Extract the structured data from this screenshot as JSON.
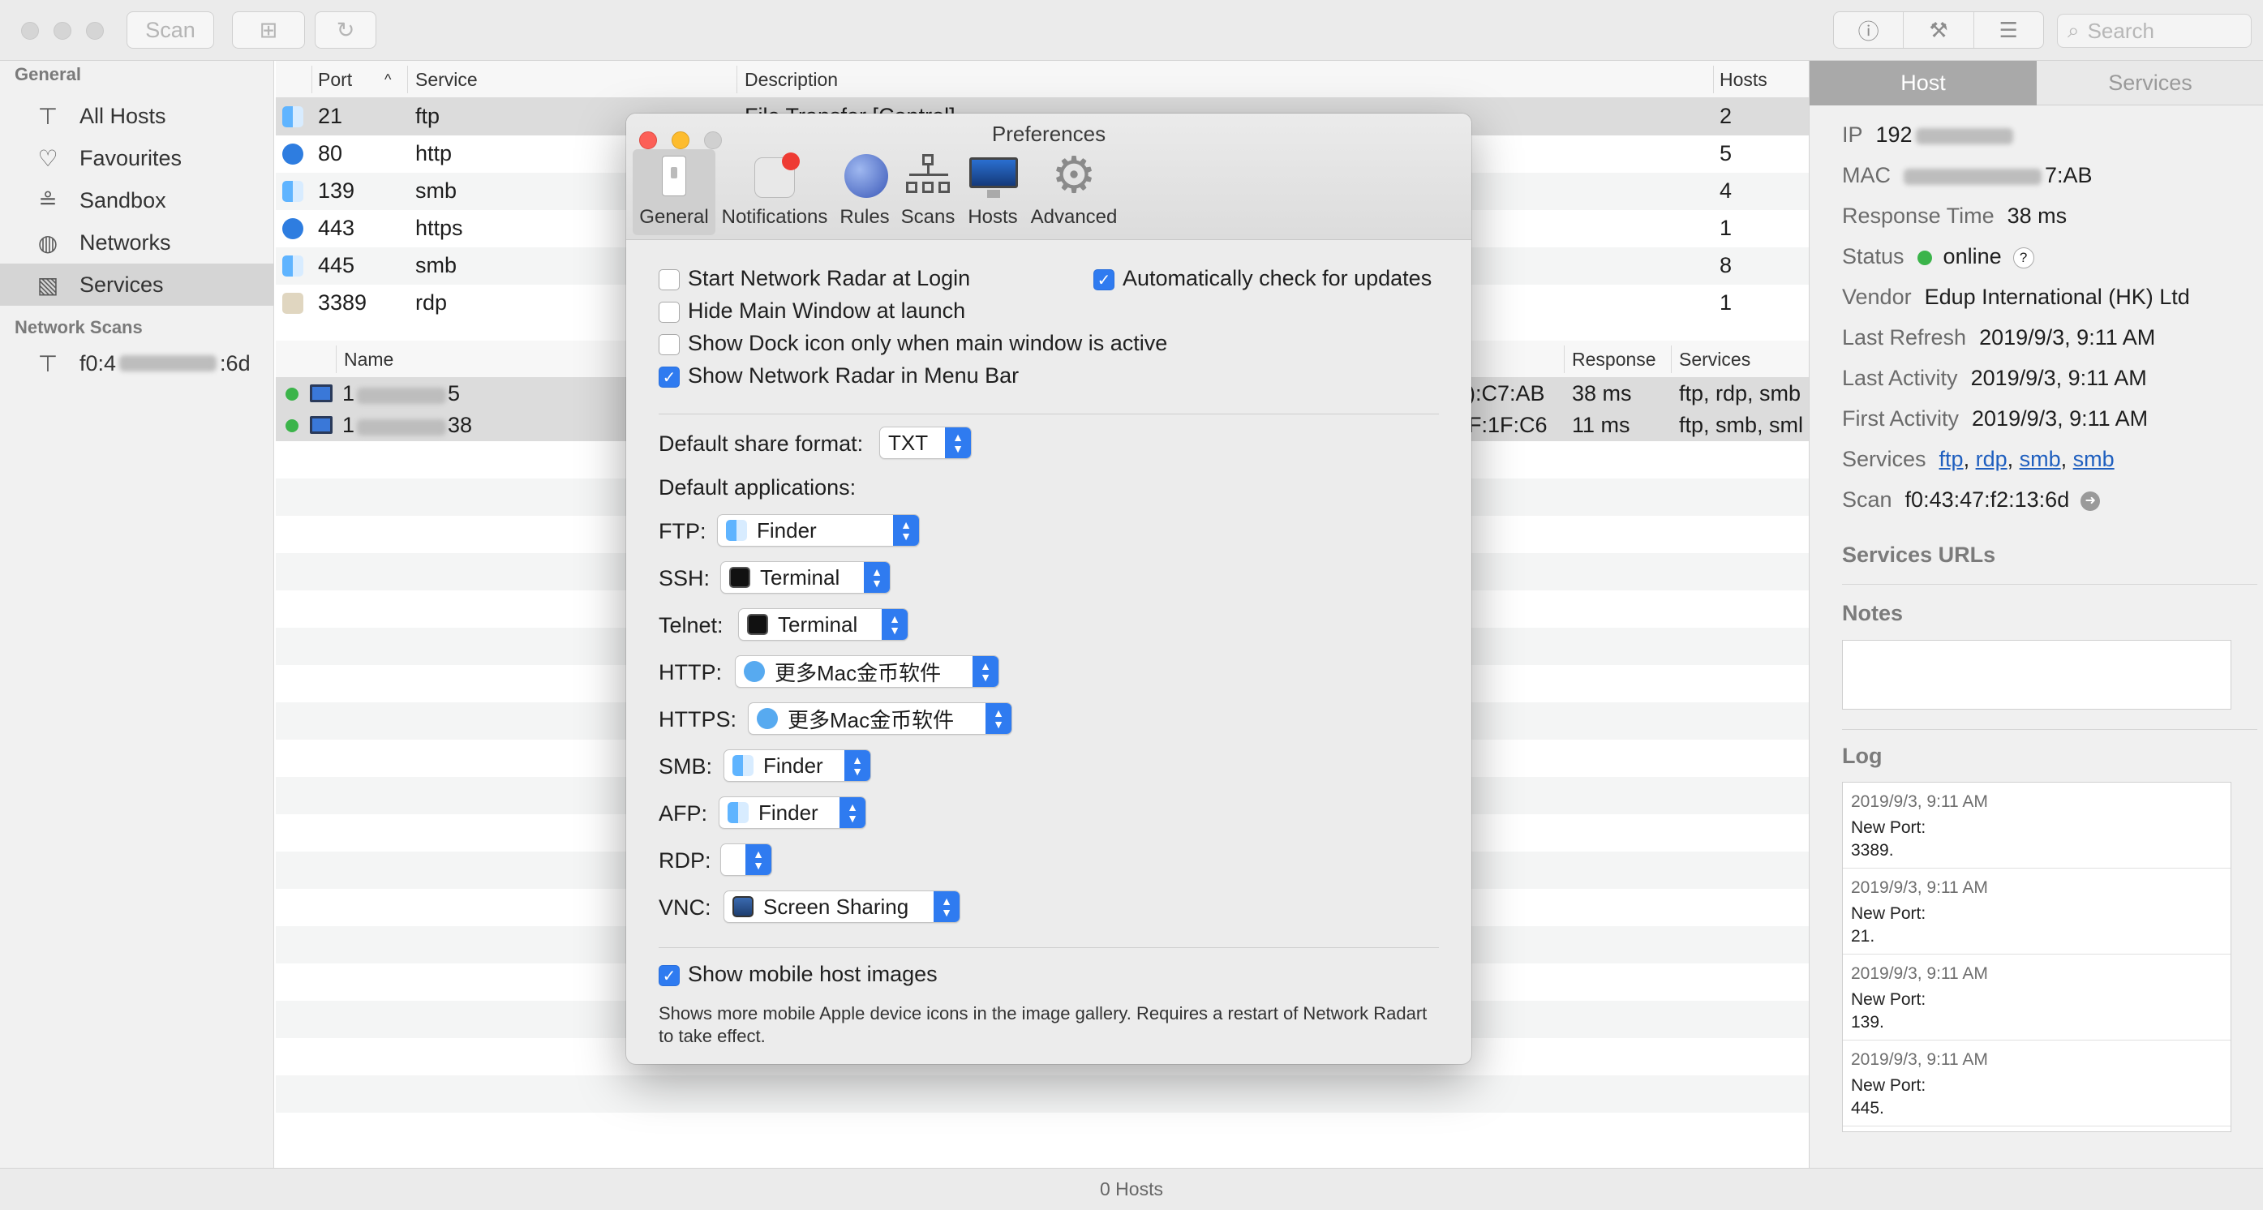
{
  "toolbar": {
    "scan_label": "Scan",
    "search_placeholder": "Search"
  },
  "sidebar": {
    "general_header": "General",
    "items": [
      {
        "label": "All Hosts",
        "icon": "hierarchy-icon"
      },
      {
        "label": "Favourites",
        "icon": "heart-icon"
      },
      {
        "label": "Sandbox",
        "icon": "sandbox-icon"
      },
      {
        "label": "Networks",
        "icon": "globe-icon"
      },
      {
        "label": "Services",
        "icon": "services-icon"
      }
    ],
    "scans_header": "Network Scans",
    "scan_item": {
      "prefix": "f0:4",
      "suffix": ":6d"
    }
  },
  "services_table": {
    "headers": {
      "port": "Port",
      "service": "Service",
      "description": "Description",
      "hosts": "Hosts"
    },
    "rows": [
      {
        "port": "21",
        "service": "ftp",
        "description": "File Transfer [Control]",
        "hosts": "2"
      },
      {
        "port": "80",
        "service": "http",
        "description": "",
        "hosts": "5"
      },
      {
        "port": "139",
        "service": "smb",
        "description": "",
        "hosts": "4"
      },
      {
        "port": "443",
        "service": "https",
        "description": "",
        "hosts": "1"
      },
      {
        "port": "445",
        "service": "smb",
        "description": "",
        "hosts": "8"
      },
      {
        "port": "3389",
        "service": "rdp",
        "description": "",
        "hosts": "1"
      }
    ]
  },
  "hosts_table": {
    "headers": {
      "name": "Name",
      "response": "Response",
      "services": "Services"
    },
    "rows": [
      {
        "name_prefix": "1",
        "name_suffix": "5",
        "mac_suffix": "):C7:AB",
        "response": "38 ms",
        "services": "ftp, rdp, smb"
      },
      {
        "name_prefix": "1",
        "name_suffix": "38",
        "mac_suffix": "F:1F:C6",
        "response": "11 ms",
        "services": "ftp, smb, sml"
      }
    ]
  },
  "inspector": {
    "tabs": [
      "Host",
      "Services"
    ],
    "ip_label": "IP",
    "ip_value": "192",
    "mac_label": "MAC",
    "mac_value": "7:AB",
    "response_label": "Response Time",
    "response_value": "38 ms",
    "status_label": "Status",
    "status_value": "online",
    "status_help": "?",
    "vendor_label": "Vendor",
    "vendor_value": "Edup International (HK) Ltd",
    "last_refresh_label": "Last Refresh",
    "last_refresh_value": "2019/9/3, 9:11 AM",
    "last_activity_label": "Last Activity",
    "last_activity_value": "2019/9/3, 9:11 AM",
    "first_activity_label": "First Activity",
    "first_activity_value": "2019/9/3, 9:11 AM",
    "services_label": "Services",
    "services_links": [
      "ftp",
      "rdp",
      "smb",
      "smb"
    ],
    "scan_label": "Scan",
    "scan_value": "f0:43:47:f2:13:6d",
    "services_urls_header": "Services URLs",
    "notes_header": "Notes",
    "log_header": "Log",
    "log": [
      {
        "date": "2019/9/3, 9:11 AM",
        "line1": "New Port:",
        "line2": "3389."
      },
      {
        "date": "2019/9/3, 9:11 AM",
        "line1": "New Port:",
        "line2": "21."
      },
      {
        "date": "2019/9/3, 9:11 AM",
        "line1": "New Port:",
        "line2": "139."
      },
      {
        "date": "2019/9/3, 9:11 AM",
        "line1": "New Port:",
        "line2": "445."
      }
    ]
  },
  "statusbar": {
    "text": "0 Hosts"
  },
  "preferences": {
    "title": "Preferences",
    "tabs": [
      {
        "label": "General",
        "icon": "switch-icon"
      },
      {
        "label": "Notifications",
        "icon": "notifications-icon"
      },
      {
        "label": "Rules",
        "icon": "globe-network-icon"
      },
      {
        "label": "Scans",
        "icon": "hierarchy-icon"
      },
      {
        "label": "Hosts",
        "icon": "imac-icon"
      },
      {
        "label": "Advanced",
        "icon": "gear-icon"
      }
    ],
    "checks": {
      "start_login": {
        "label": "Start Network Radar at Login",
        "checked": false
      },
      "hide_main": {
        "label": "Hide Main Window at launch",
        "checked": false
      },
      "dock_icon": {
        "label": "Show Dock icon only when main window is active",
        "checked": false
      },
      "menu_bar": {
        "label": "Show Network Radar in Menu Bar",
        "checked": true
      },
      "auto_update": {
        "label": "Automatically check for updates",
        "checked": true
      },
      "mobile_images": {
        "label": "Show mobile host images",
        "checked": true
      }
    },
    "share_format_label": "Default share format:",
    "share_format_value": "TXT",
    "default_apps_label": "Default applications:",
    "apps": {
      "ftp": {
        "label": "FTP:",
        "value": "Finder"
      },
      "ssh": {
        "label": "SSH:",
        "value": "Terminal"
      },
      "telnet": {
        "label": "Telnet:",
        "value": "Terminal"
      },
      "http": {
        "label": "HTTP:",
        "value": "更多Mac金币软件"
      },
      "https": {
        "label": "HTTPS:",
        "value": "更多Mac金币软件"
      },
      "smb": {
        "label": "SMB:",
        "value": "Finder"
      },
      "afp": {
        "label": "AFP:",
        "value": "Finder"
      },
      "rdp": {
        "label": "RDP:",
        "value": ""
      },
      "vnc": {
        "label": "VNC:",
        "value": "Screen Sharing"
      }
    },
    "mobile_note": "Shows more mobile Apple device icons in the image gallery. Requires a restart of Network Radart to take effect."
  },
  "colors": {
    "accent": "#2f7bf0",
    "online": "#3bb44a",
    "link": "#1f5fbf",
    "close": "#fc5f57",
    "minimize": "#fdbc2e"
  }
}
